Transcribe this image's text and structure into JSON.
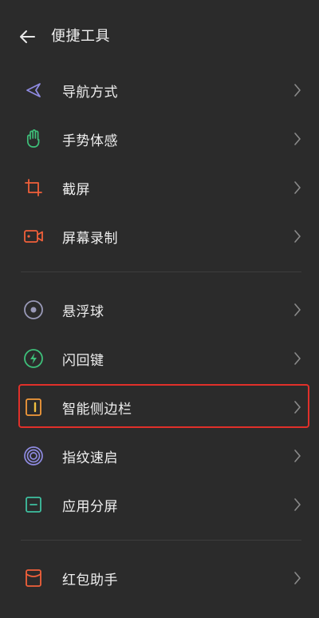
{
  "header": {
    "back_icon": "arrow-left-icon",
    "title": "便捷工具"
  },
  "groups": [
    {
      "items": [
        {
          "label": "导航方式",
          "icon": "navigation-icon",
          "icon_color": "#8e8ae0"
        },
        {
          "label": "手势体感",
          "icon": "hand-gesture-icon",
          "icon_color": "#3ec07a"
        },
        {
          "label": "截屏",
          "icon": "crop-screenshot-icon",
          "icon_color": "#f1603a"
        },
        {
          "label": "屏幕录制",
          "icon": "video-record-icon",
          "icon_color": "#f1603a"
        }
      ]
    },
    {
      "items": [
        {
          "label": "悬浮球",
          "icon": "floating-ball-icon",
          "icon_color": "#9a9ab8"
        },
        {
          "label": "闪回键",
          "icon": "flashback-icon",
          "icon_color": "#3ec07a"
        },
        {
          "label": "智能侧边栏",
          "icon": "smart-sidebar-icon",
          "icon_color": "#f39a3a",
          "highlighted": true
        },
        {
          "label": "指纹速启",
          "icon": "fingerprint-icon",
          "icon_color": "#8e8ae0"
        },
        {
          "label": "应用分屏",
          "icon": "split-screen-icon",
          "icon_color": "#3ec0a0"
        }
      ]
    },
    {
      "items": [
        {
          "label": "红包助手",
          "icon": "red-envelope-icon",
          "icon_color": "#f1603a"
        }
      ]
    }
  ],
  "chevron_icon": "chevron-right-icon",
  "highlight_color": "#e0302a"
}
